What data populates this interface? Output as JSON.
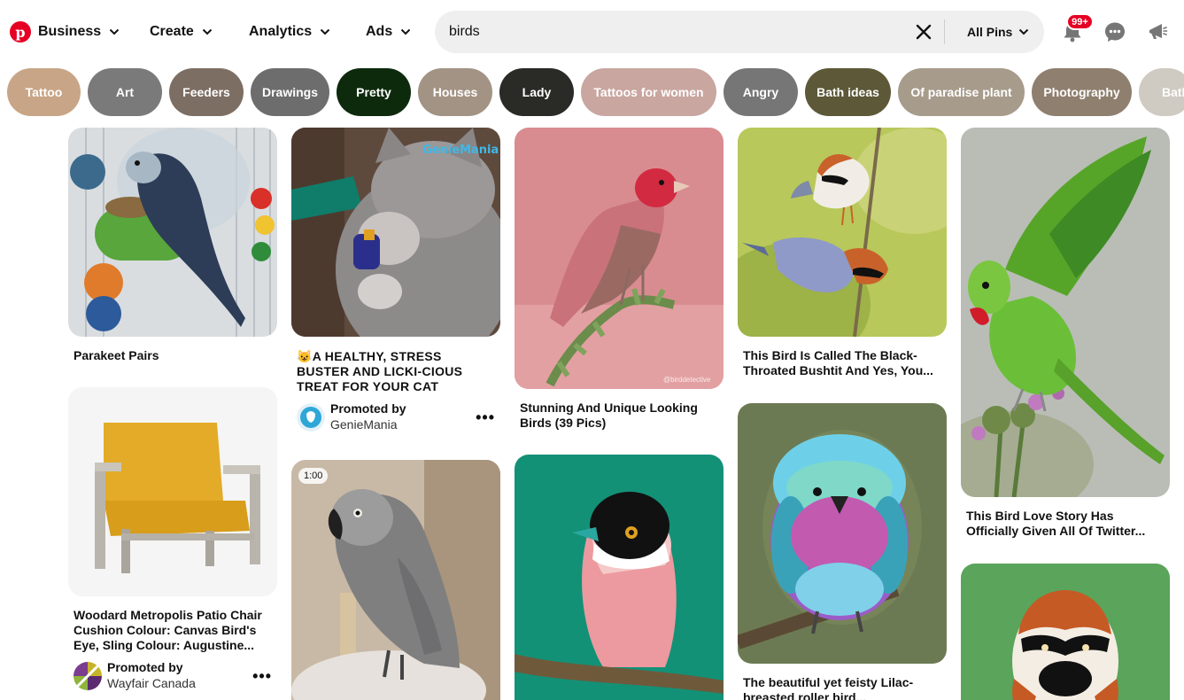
{
  "nav": {
    "business": "Business",
    "create": "Create",
    "analytics": "Analytics",
    "ads": "Ads"
  },
  "search": {
    "query": "birds",
    "scope": "All Pins"
  },
  "notifications": {
    "badge": "99+"
  },
  "chips": [
    {
      "label": "Tattoo",
      "color": "#c8a587"
    },
    {
      "label": "Art",
      "color": "#7a7a7a"
    },
    {
      "label": "Feeders",
      "color": "#7d6e63"
    },
    {
      "label": "Drawings",
      "color": "#6d6d6d"
    },
    {
      "label": "Pretty",
      "color": "#0e2a0c"
    },
    {
      "label": "Houses",
      "color": "#a39384"
    },
    {
      "label": "Lady",
      "color": "#2a2a26"
    },
    {
      "label": "Tattoos for women",
      "color": "#c9a6a0"
    },
    {
      "label": "Angry",
      "color": "#767676"
    },
    {
      "label": "Bath ideas",
      "color": "#5c5838"
    },
    {
      "label": "Of paradise plant",
      "color": "#a79b8b"
    },
    {
      "label": "Photography",
      "color": "#8f7f6f"
    },
    {
      "label": "Bath",
      "color": "#cfcac2"
    }
  ],
  "pins": {
    "parakeet": {
      "title": "Parakeet Pairs"
    },
    "cat": {
      "title": "😺A HEALTHY, STRESS BUSTER AND LICKI-CIOUS TREAT FOR YOUR CAT",
      "promoted_label": "Promoted by",
      "advertiser": "GenieMania",
      "watermark": "GenieMania"
    },
    "finch": {
      "title": "Stunning And Unique Looking Birds (39 Pics)",
      "watermark": "@birddetective"
    },
    "bushtit": {
      "title": "This Bird Is Called The Black-Throated Bushtit And Yes, You..."
    },
    "ringneck": {
      "title": "This Bird Love Story Has Officially Given All Of Twitter..."
    },
    "chair": {
      "title": "Woodard Metropolis Patio Chair Cushion Colour: Canvas Bird's Eye, Sling Colour: Augustine...",
      "promoted_label": "Promoted by",
      "advertiser": "Wayfair Canada"
    },
    "greyparrot": {
      "duration": "1:00"
    },
    "roller": {
      "title": "The beautiful yet feisty Lilac-breasted roller bird..."
    }
  },
  "more_label": "•••"
}
